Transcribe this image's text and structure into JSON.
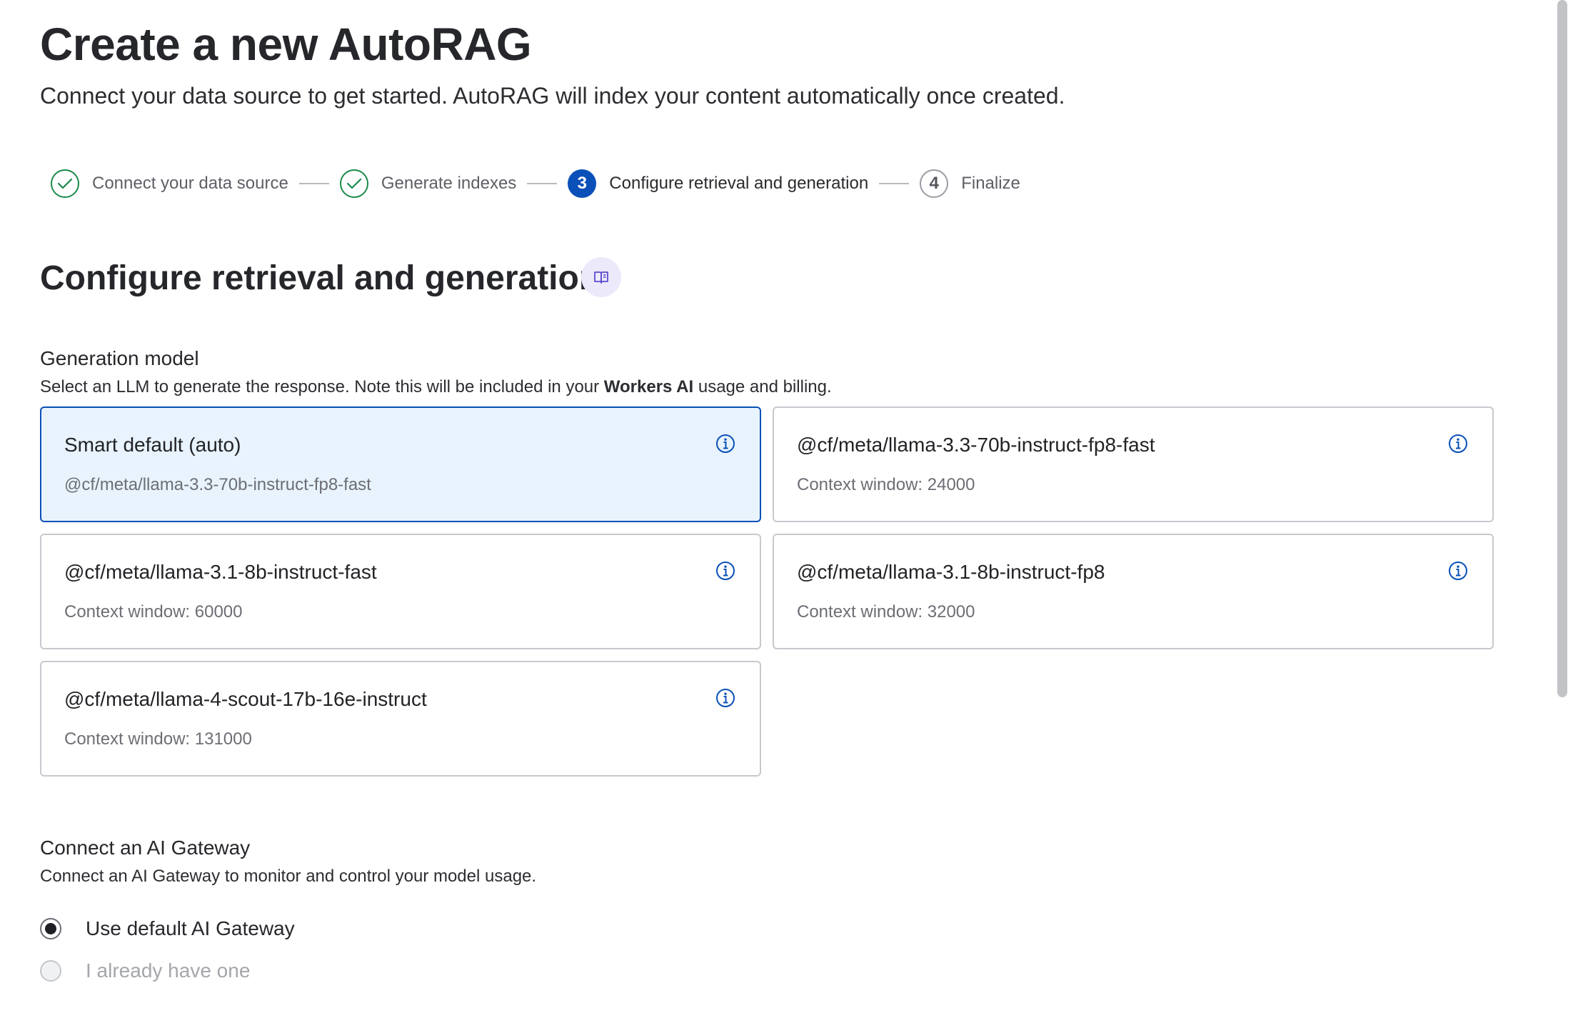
{
  "header": {
    "title": "Create a new AutoRAG",
    "subtitle": "Connect your data source to get started. AutoRAG will index your content automatically once created."
  },
  "stepper": {
    "steps": [
      {
        "label": "Connect your data source",
        "state": "done"
      },
      {
        "label": "Generate indexes",
        "state": "done"
      },
      {
        "label": "Configure retrieval and generation",
        "state": "active",
        "number": "3"
      },
      {
        "label": "Finalize",
        "state": "pending",
        "number": "4"
      }
    ]
  },
  "section": {
    "title": "Configure retrieval and generation",
    "docs_icon": "book-icon"
  },
  "generation_model": {
    "label": "Generation model",
    "help_prefix": "Select an LLM to generate the response. Note this will be included in your ",
    "help_bold": "Workers AI",
    "help_suffix": " usage and billing.",
    "selected_index": 0,
    "options": [
      {
        "name": "Smart default (auto)",
        "sub": "@cf/meta/llama-3.3-70b-instruct-fp8-fast"
      },
      {
        "name": "@cf/meta/llama-3.3-70b-instruct-fp8-fast",
        "sub": "Context window: 24000"
      },
      {
        "name": "@cf/meta/llama-3.1-8b-instruct-fast",
        "sub": "Context window: 60000"
      },
      {
        "name": "@cf/meta/llama-3.1-8b-instruct-fp8",
        "sub": "Context window: 32000"
      },
      {
        "name": "@cf/meta/llama-4-scout-17b-16e-instruct",
        "sub": "Context window: 131000"
      }
    ]
  },
  "ai_gateway": {
    "label": "Connect an AI Gateway",
    "help": "Connect an AI Gateway to monitor and control your model usage.",
    "options": [
      {
        "label": "Use default AI Gateway",
        "checked": true,
        "disabled": false
      },
      {
        "label": "I already have one",
        "checked": false,
        "disabled": true
      }
    ]
  },
  "colors": {
    "accent": "#0a50b8",
    "success": "#1a8a4a",
    "selected_bg": "#e8f3fd",
    "docs_button_bg": "#ece9fb"
  }
}
